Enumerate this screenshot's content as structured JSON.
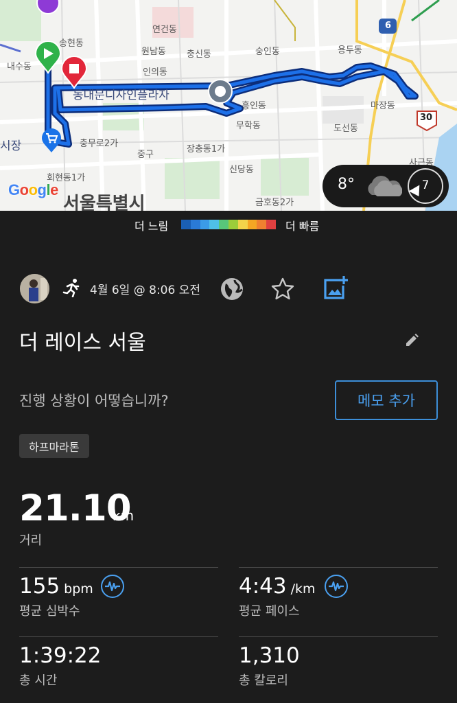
{
  "map": {
    "labels": {
      "yeongeon": "연건동",
      "songhyeon": "송현동",
      "wonnam": "원남동",
      "chungsin": "충신동",
      "sungin": "숭인동",
      "yongdu": "용두동",
      "naesu": "내수동",
      "inui": "인의동",
      "ddp": "동대문디자인플라자",
      "heungin": "흥인동",
      "majang": "마장동",
      "muhak": "무학동",
      "doseon": "도선동",
      "sijang": "시장",
      "chungmuro": "충무로2가",
      "junggu": "중구",
      "jangchung": "장충동1가",
      "sindang": "신당동",
      "sageun": "사근동",
      "hoehyeon": "회현동1가",
      "geumho": "금호동2가",
      "seoul": "서울특별시",
      "road6": "6",
      "road30": "30"
    },
    "google": [
      "G",
      "o",
      "o",
      "g",
      "l",
      "e"
    ],
    "weather": {
      "temp": "8°",
      "wind": "7",
      "icon": "cloud-icon"
    }
  },
  "speed_legend": {
    "slow": "더 느림",
    "fast": "더 빠름",
    "colors": [
      "#1a5fb4",
      "#2a7ad6",
      "#3b9be8",
      "#4fc0e8",
      "#58c67a",
      "#9ccc3a",
      "#f2d34a",
      "#f5a623",
      "#f08030",
      "#e04040"
    ]
  },
  "activity": {
    "date": "4월 6일 @ 8:06 오전",
    "title": "더 레이스 서울",
    "prompt": "진행 상황이 어떻습니까?",
    "memo_button": "메모 추가",
    "tag": "하프마라톤"
  },
  "stats": {
    "distance": {
      "value": "21.10",
      "unit": "km",
      "label": "거리"
    },
    "heart_rate": {
      "value": "155",
      "unit": "bpm",
      "label": "평균 심박수"
    },
    "pace": {
      "value": "4:43",
      "unit": "/km",
      "label": "평균 페이스"
    },
    "time": {
      "value": "1:39:22",
      "label": "총 시간"
    },
    "calories": {
      "value": "1,310",
      "label": "총 칼로리"
    }
  },
  "colors": {
    "accent": "#3d8fd9",
    "route": "#1560d6",
    "background": "#1c1c1c"
  }
}
